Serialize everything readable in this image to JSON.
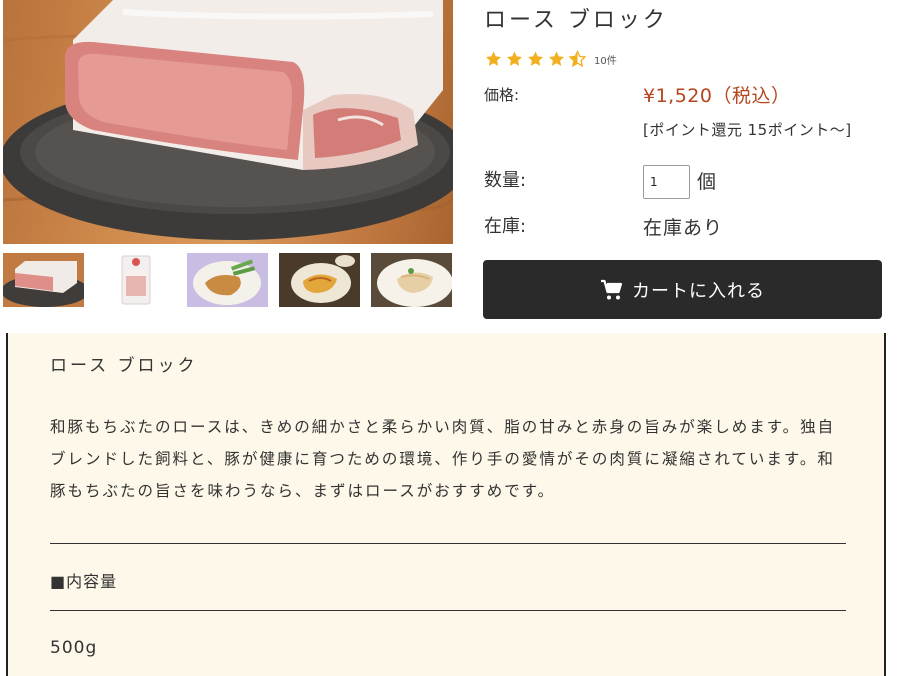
{
  "product": {
    "title": "ロース ブロック",
    "rating": 4.5,
    "review_count": "10件",
    "price_label": "価格:",
    "price": "¥1,520（税込）",
    "points": "[ポイント還元 15ポイント～]",
    "quantity_label": "数量:",
    "quantity_value": "1",
    "quantity_unit": "個",
    "stock_label": "在庫:",
    "stock_value": "在庫あり",
    "cart_button_label": "カートに入れる"
  },
  "icons": {
    "star": "star-icon",
    "cart": "cart-icon"
  },
  "colors": {
    "price": "#b5461d",
    "star": "#f2b01e",
    "button": "#2a2a2a",
    "panel_background": "#fdf8e9"
  },
  "thumbnails": [
    {
      "name": "thumbnail-pork-block"
    },
    {
      "name": "thumbnail-package"
    },
    {
      "name": "thumbnail-grilled-dish"
    },
    {
      "name": "thumbnail-tonkatsu-dish"
    },
    {
      "name": "thumbnail-sauteed-dish"
    }
  ],
  "description": {
    "title": "ロース ブロック",
    "body": "和豚もちぶたのロースは、きめの細かさと柔らかい肉質、脂の甘みと赤身の旨みが楽しめます。独自ブレンドした飼料と、豚が健康に育つための環境、作り手の愛情がその肉質に凝縮されています。和豚もちぶたの旨さを味わうなら、まずはロースがおすすめです。",
    "spec_heading": "■内容量",
    "spec_value": "500g"
  }
}
